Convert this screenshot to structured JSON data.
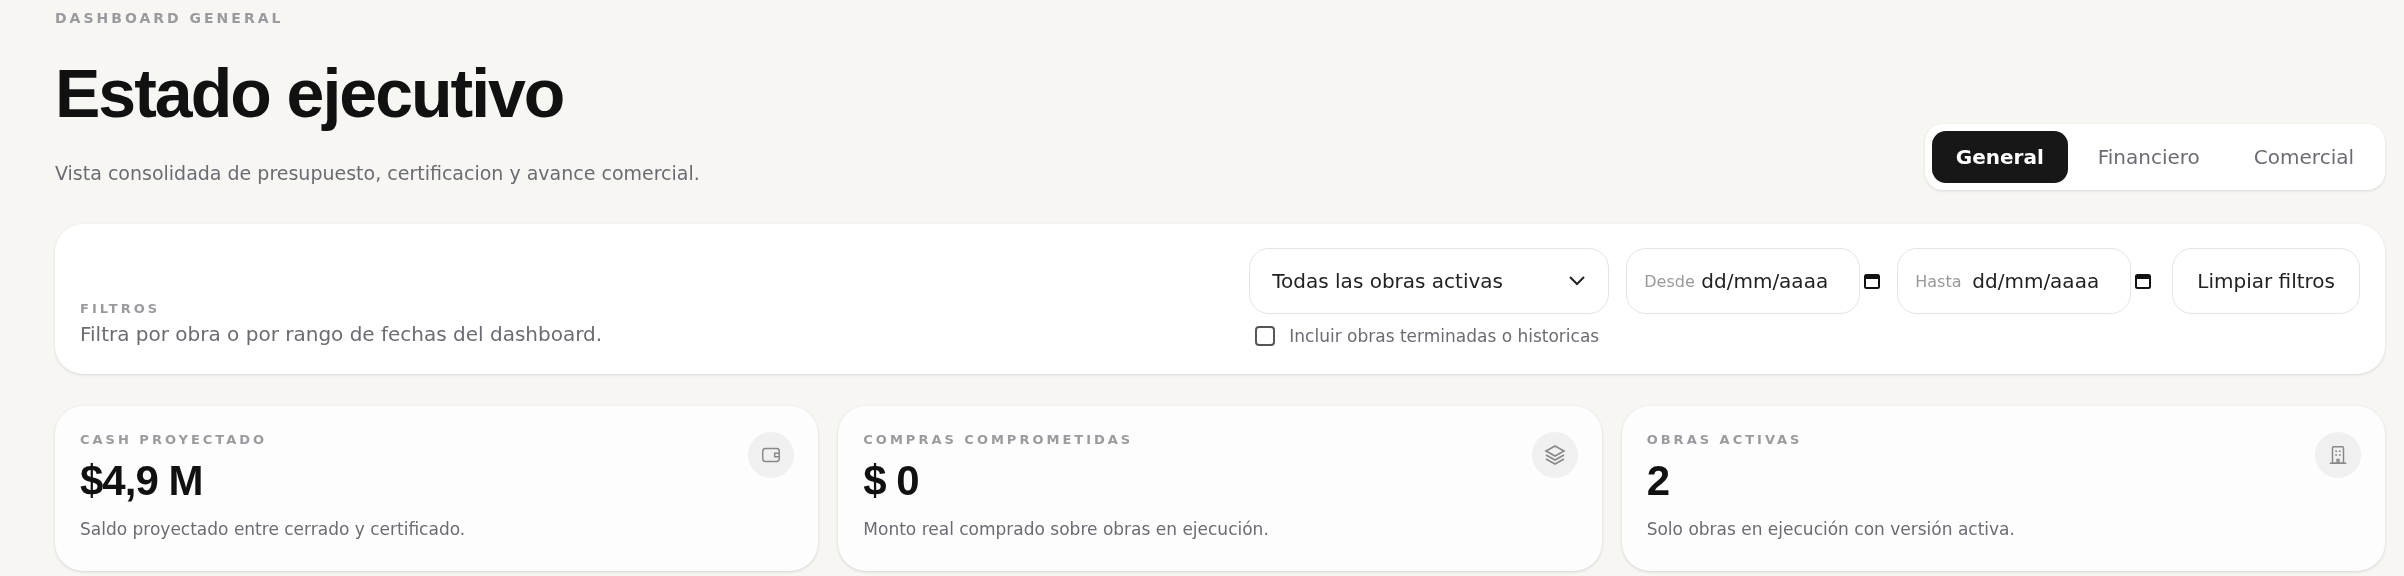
{
  "header": {
    "eyebrow": "DASHBOARD GENERAL",
    "title": "Estado ejecutivo",
    "subtitle": "Vista consolidada de presupuesto, certificacion y avance comercial."
  },
  "tabs": [
    {
      "label": "General",
      "selected": true
    },
    {
      "label": "Financiero",
      "selected": false
    },
    {
      "label": "Comercial",
      "selected": false
    }
  ],
  "filters": {
    "eyebrow": "FILTROS",
    "description": "Filtra por obra o por rango de fechas del dashboard.",
    "select": {
      "value": "Todas las obras activas"
    },
    "dates": [
      {
        "label": "Desde",
        "placeholder": "dd/mm/aaaa"
      },
      {
        "label": "Hasta",
        "placeholder": "dd/mm/aaaa"
      }
    ],
    "clear_button": "Limpiar filtros",
    "include_finished": {
      "label": "Incluir obras terminadas o historicas",
      "checked": false
    }
  },
  "cards": [
    {
      "kind": "wallet",
      "label": "CASH PROYECTADO",
      "value": "$4,9 M",
      "note": "Saldo proyectado entre cerrado y certificado."
    },
    {
      "kind": "layers",
      "label": "COMPRAS COMPROMETIDAS",
      "value": "$ 0",
      "note": "Monto real comprado sobre obras en ejecución."
    },
    {
      "kind": "building",
      "label": "OBRAS ACTIVAS",
      "value": "2",
      "note": "Solo obras en ejecución con versión activa."
    }
  ]
}
